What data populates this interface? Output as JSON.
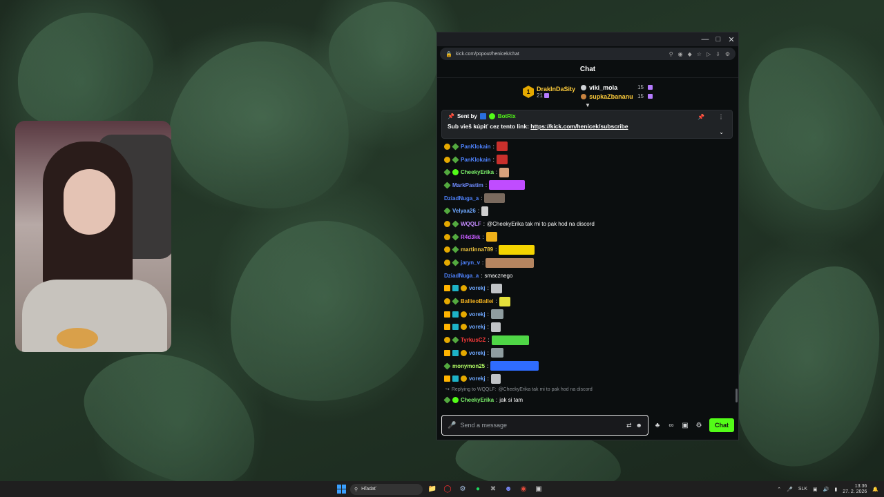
{
  "window": {
    "url": "kick.com/popout/henicek/chat"
  },
  "chat": {
    "title": "Chat",
    "leaderboard": {
      "top": {
        "rank": "1",
        "name": "DrakInDaSity",
        "count": "21"
      },
      "others": [
        {
          "name": "viki_mola",
          "count": "15"
        },
        {
          "name": "supkaZbananu",
          "count": "15"
        }
      ]
    },
    "pinned": {
      "sent_by_label": "Sent by",
      "bot_name": "BotRix",
      "message_prefix": "Sub vieš kúpiť cez tento link: ",
      "link": "https://kick.com/henicek/subscribe"
    },
    "messages": [
      {
        "badges": [
          "gold",
          "gem"
        ],
        "user": "PanKlokain",
        "color": "#4f83ff",
        "text": "",
        "emote": {
          "w": 16,
          "color": "#c9302c"
        }
      },
      {
        "badges": [
          "gold",
          "gem"
        ],
        "user": "PanKlokain",
        "color": "#4f83ff",
        "text": "",
        "emote": {
          "w": 16,
          "color": "#c9302c"
        }
      },
      {
        "badges": [
          "gem",
          "verified"
        ],
        "user": "CheekyErika",
        "color": "#7cf26b",
        "text": "",
        "emote": {
          "w": 14,
          "color": "#d9a27d"
        }
      },
      {
        "badges": [
          "gem"
        ],
        "user": "MarkPastim",
        "color": "#6f8cff",
        "text": "",
        "emote": {
          "w": 52,
          "color": "#c04cff"
        }
      },
      {
        "badges": [],
        "user": "DziadNuga_a",
        "color": "#4f83ff",
        "text": "",
        "emote": {
          "w": 30,
          "color": "#7a6a5e"
        }
      },
      {
        "badges": [
          "gem"
        ],
        "user": "Velyaa26",
        "color": "#6fa8ff",
        "text": "",
        "emote": {
          "w": 10,
          "color": "#cfcfcf"
        }
      },
      {
        "badges": [
          "gold",
          "gem"
        ],
        "user": "WQQLF",
        "color": "#c58cff",
        "text": "@CheekyErika tak mi to pak hod na discord",
        "emote": null
      },
      {
        "badges": [
          "gold",
          "gem"
        ],
        "user": "R4d3kk",
        "color": "#c65cff",
        "text": "",
        "emote": {
          "w": 16,
          "color": "#f0b21a"
        }
      },
      {
        "badges": [
          "gold",
          "gem"
        ],
        "user": "martinna789",
        "color": "#f3c73f",
        "text": "",
        "emote": {
          "w": 52,
          "color": "#f5d400"
        }
      },
      {
        "badges": [
          "gold",
          "gem"
        ],
        "user": "jaryn_v",
        "color": "#4f83ff",
        "text": "",
        "emote": {
          "w": 70,
          "color": "#b58560"
        }
      },
      {
        "badges": [],
        "user": "DziadNuga_a",
        "color": "#4f83ff",
        "text": "smacznego",
        "emote": null
      },
      {
        "badges": [
          "crown",
          "sub",
          "gold"
        ],
        "user": "vorekj",
        "color": "#6fa8ff",
        "text": "",
        "emote": {
          "w": 16,
          "color": "#c0c3c6"
        }
      },
      {
        "badges": [
          "gold",
          "gem"
        ],
        "user": "BallieoBallei",
        "color": "#f0b020",
        "text": "",
        "emote": {
          "w": 16,
          "color": "#e5e13b"
        }
      },
      {
        "badges": [
          "crown",
          "sub",
          "gold"
        ],
        "user": "vorekj",
        "color": "#6fa8ff",
        "text": "",
        "emote": {
          "w": 18,
          "color": "#8f9da0"
        }
      },
      {
        "badges": [
          "crown",
          "sub",
          "gold"
        ],
        "user": "vorekj",
        "color": "#6fa8ff",
        "text": "",
        "emote": {
          "w": 14,
          "color": "#c0c3c6"
        }
      },
      {
        "badges": [
          "gold",
          "gem"
        ],
        "user": "TyrkusCZ",
        "color": "#ff3b3b",
        "text": "",
        "emote": {
          "w": 54,
          "color": "#4fd646"
        }
      },
      {
        "badges": [
          "crown",
          "sub",
          "gold"
        ],
        "user": "vorekj",
        "color": "#6fa8ff",
        "text": "",
        "emote": {
          "w": 18,
          "color": "#8f9da0"
        }
      },
      {
        "badges": [
          "gem"
        ],
        "user": "monymon25",
        "color": "#b4ff66",
        "text": "",
        "emote": {
          "w": 70,
          "color": "#2f6cff"
        }
      },
      {
        "badges": [
          "crown",
          "sub",
          "gold"
        ],
        "user": "vorekj",
        "color": "#6fa8ff",
        "text": "",
        "emote": {
          "w": 14,
          "color": "#c0c3c6"
        }
      }
    ],
    "reply": {
      "label": "Replying to WQQLF:",
      "quote": "@CheekyErika tak mi to pak hod na discord"
    },
    "last_message": {
      "user": "CheekyErika",
      "color": "#7cf26b",
      "text": "jak si tam"
    },
    "input": {
      "placeholder": "Send a message"
    },
    "send_label": "Chat"
  },
  "taskbar": {
    "search_label": "Hľadať",
    "language": "SLK",
    "time": "13:36",
    "date": "27. 2. 2026"
  }
}
